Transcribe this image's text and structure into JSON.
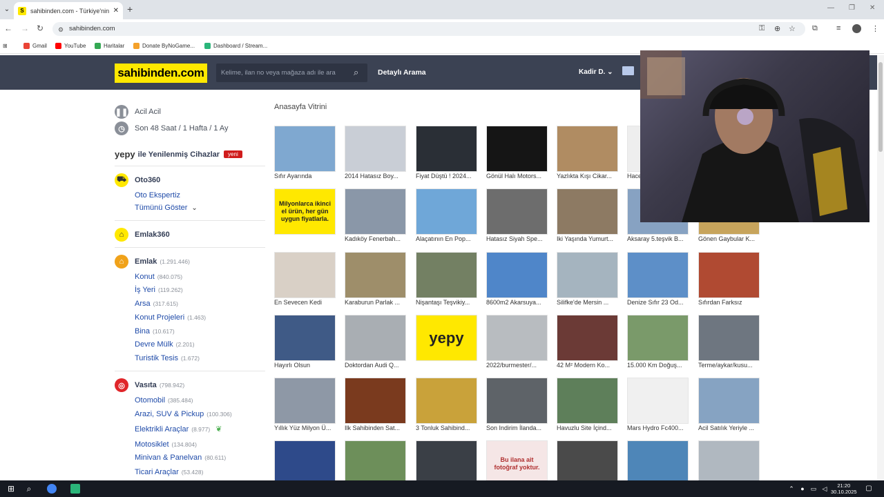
{
  "browser": {
    "tab_title": "sahibinden.com - Türkiye'nin O",
    "url": "sahibinden.com",
    "bookmarks": [
      {
        "label": "Gmail",
        "color": "#ea4335"
      },
      {
        "label": "YouTube",
        "color": "#ff0000"
      },
      {
        "label": "Haritalar",
        "color": "#34a853"
      },
      {
        "label": "Donate ByNoGame...",
        "color": "#f4a12a"
      },
      {
        "label": "Dashboard / Stream...",
        "color": "#2bb57a"
      }
    ]
  },
  "header": {
    "logo": "sahibinden.com",
    "search_placeholder": "Kelime, ilan no veya mağaza adı ile ara",
    "detailed_search": "Detaylı Arama",
    "user": "Kadir D."
  },
  "sidebar": {
    "urgent": "Acil Acil",
    "recent": "Son 48 Saat / 1 Hafta / 1 Ay",
    "yepy_brand": "yepy",
    "yepy_text": "ile Yenilenmiş Cihazlar",
    "yepy_badge": "yeni",
    "oto360": "Oto360",
    "oto_ekspertiz": "Oto Ekspertiz",
    "show_all": "Tümünü Göster",
    "emlak360": "Emlak360",
    "emlak": {
      "label": "Emlak",
      "count": "(1.291.446)"
    },
    "emlak_items": [
      {
        "label": "Konut",
        "count": "(840.075)"
      },
      {
        "label": "İş Yeri",
        "count": "(119.262)"
      },
      {
        "label": "Arsa",
        "count": "(317.615)"
      },
      {
        "label": "Konut Projeleri",
        "count": "(1.463)"
      },
      {
        "label": "Bina",
        "count": "(10.617)"
      },
      {
        "label": "Devre Mülk",
        "count": "(2.201)"
      },
      {
        "label": "Turistik Tesis",
        "count": "(1.672)"
      }
    ],
    "vasita": {
      "label": "Vasıta",
      "count": "(798.942)"
    },
    "vasita_items": [
      {
        "label": "Otomobil",
        "count": "(385.484)"
      },
      {
        "label": "Arazi, SUV & Pickup",
        "count": "(100.306)"
      },
      {
        "label": "Elektrikli Araçlar",
        "count": "(8.977)"
      },
      {
        "label": "Motosiklet",
        "count": "(134.804)"
      },
      {
        "label": "Minivan & Panelvan",
        "count": "(80.611)"
      },
      {
        "label": "Ticari Araçlar",
        "count": "(53.428)"
      }
    ]
  },
  "showcase": {
    "title": "Anasayfa Vitrini",
    "rows": [
      [
        {
          "caption": "Sıfır Ayarında",
          "color": "#7fa8d0"
        },
        {
          "caption": "2014 Hatasız Boy...",
          "color": "#c9ced6"
        },
        {
          "caption": "Fiyat Düştü ! 2024...",
          "color": "#2a2f36"
        },
        {
          "caption": "Gönül Halı Motors...",
          "color": "#151515"
        },
        {
          "caption": "Yazlıkta Kışı Cikar...",
          "color": "#b08c62"
        },
        {
          "caption": "Hace...",
          "color": "#eeeeee"
        }
      ],
      [
        {
          "caption": "",
          "color": "#ffe800",
          "promo": "Milyonlarca ikinci el ürün, her gün uygun fiyatlarla."
        },
        {
          "caption": "Kadıköy Fenerbah...",
          "color": "#8a97a8"
        },
        {
          "caption": "Alaçatının En Pop...",
          "color": "#6fa7d8"
        },
        {
          "caption": "Hatasız Siyah Spe...",
          "color": "#6d6d6d"
        },
        {
          "caption": "Iki Yaşında Yumurt...",
          "color": "#8d7a63"
        },
        {
          "caption": "Aksaray 5.teşvik B...",
          "color": "#87a2c2"
        },
        {
          "caption": "Gönen Gaybular K...",
          "color": "#c7a45c"
        }
      ],
      [
        {
          "caption": "En Sevecen Kedi",
          "color": "#d9d0c6"
        },
        {
          "caption": "Karaburun Parlak ...",
          "color": "#9e8e6a"
        },
        {
          "caption": "Nişantaşı Teşvikiy...",
          "color": "#738063"
        },
        {
          "caption": "8600m2 Akarsuya...",
          "color": "#4f86c9"
        },
        {
          "caption": "Silifke'de Mersin ...",
          "color": "#a5b4bf"
        },
        {
          "caption": "Denize Sıfır 23 Od...",
          "color": "#5d8fc8"
        },
        {
          "caption": "Sıfırdan Farksız",
          "color": "#b04a32"
        }
      ],
      [
        {
          "caption": "Hayırlı Olsun",
          "color": "#3f5a86"
        },
        {
          "caption": "Doktordan Audi Q...",
          "color": "#a9aeb3"
        },
        {
          "caption": "",
          "color": "#ffe800",
          "promo": "yepy"
        },
        {
          "caption": "2022/burmester/...",
          "color": "#b8bcc0"
        },
        {
          "caption": "42 M² Modern Ko...",
          "color": "#6b3a36"
        },
        {
          "caption": "15.000 Km Doğuş...",
          "color": "#7a9a6a"
        },
        {
          "caption": "Terme/aykar/kusu...",
          "color": "#6e7680"
        }
      ],
      [
        {
          "caption": "Yıllık Yüz Milyon Ü...",
          "color": "#8e98a6"
        },
        {
          "caption": "Ilk Sahibinden Sat...",
          "color": "#7a3a1e"
        },
        {
          "caption": "3 Tonluk Sahibind...",
          "color": "#c9a23a"
        },
        {
          "caption": "Son Indirim İlanda...",
          "color": "#5e6368"
        },
        {
          "caption": "Havuzlu Site İçind...",
          "color": "#5e7f5a"
        },
        {
          "caption": "Mars Hydro Fc400...",
          "color": "#f0f0f0"
        },
        {
          "caption": "Acil Satılık Yeriyle ...",
          "color": "#86a3c2"
        }
      ],
      [
        {
          "caption": "",
          "color": "#2e4a8a"
        },
        {
          "caption": "",
          "color": "#6d8f5a"
        },
        {
          "caption": "",
          "color": "#3a3f46"
        },
        {
          "caption": "",
          "color": "#f5e6e6",
          "promo": "Bu ilana ait fotoğraf yoktur."
        },
        {
          "caption": "",
          "color": "#4a4a4a"
        },
        {
          "caption": "",
          "color": "#4e86b8"
        },
        {
          "caption": "",
          "color": "#b0b8c0"
        }
      ]
    ]
  },
  "taskbar": {
    "time": "21:20",
    "date": "30.10.2025"
  }
}
